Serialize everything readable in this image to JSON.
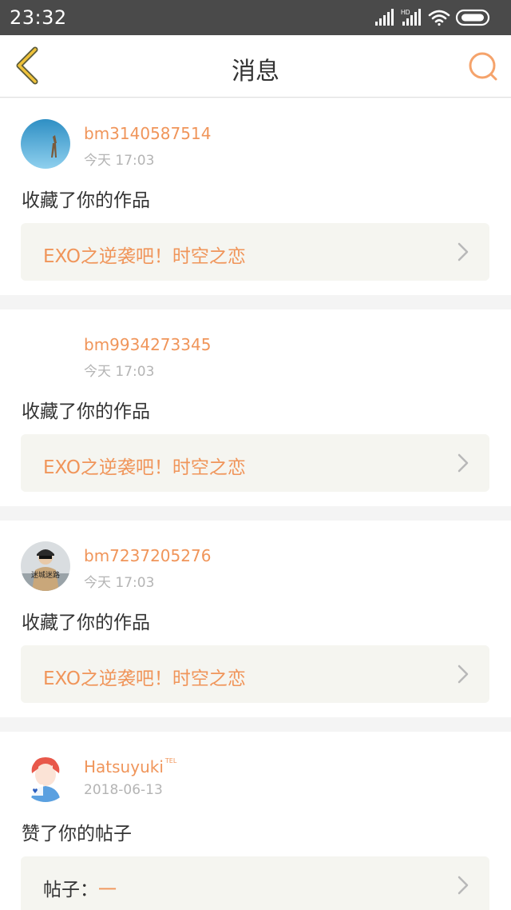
{
  "status_bar": {
    "time": "23:32",
    "hd_label": "HD",
    "icons": [
      "signal-icon",
      "hd-signal-icon",
      "wifi-icon",
      "battery-icon"
    ]
  },
  "nav": {
    "title": "消息",
    "back_icon": "chevron-left-icon",
    "search_icon": "search-icon"
  },
  "colors": {
    "accent": "#f0955a",
    "nav_icon": "#f5a36b",
    "back_icon": "#efc23a",
    "text": "#333333",
    "muted": "#b4b4b4",
    "status_bar": "#4a4a4a"
  },
  "messages": [
    {
      "username": "bm3140587514",
      "badge": "",
      "time": "今天 17:03",
      "action": "收藏了你的作品",
      "work_title": "EXO之逆袭吧！时空之恋",
      "avatar": "giraffe-sky"
    },
    {
      "username": "bm9934273345",
      "badge": "",
      "time": "今天 17:03",
      "action": "收藏了你的作品",
      "work_title": "EXO之逆袭吧！时空之恋",
      "avatar": "blank"
    },
    {
      "username": "bm7237205276",
      "badge": "",
      "time": "今天 17:03",
      "action": "收藏了你的作品",
      "work_title": "EXO之逆袭吧！时空之恋",
      "avatar": "photo-person",
      "avatar_caption": "迷城迷路"
    },
    {
      "username": "Hatsuyuki",
      "badge": "TEL",
      "time": "2018-06-13",
      "action": "赞了你的帖子",
      "post_label": "帖子：",
      "post_title": "一",
      "avatar": "anime-red-hair"
    }
  ]
}
